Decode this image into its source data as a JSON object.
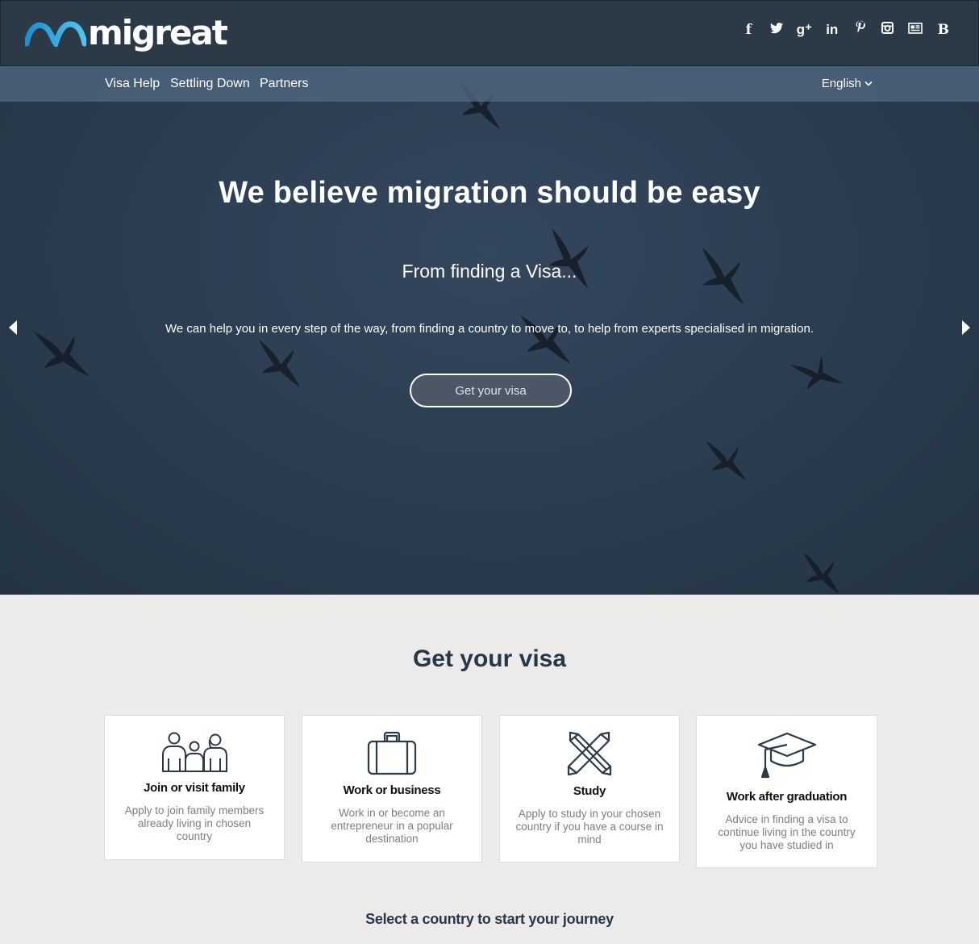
{
  "brand": {
    "name": "migreat"
  },
  "social": [
    {
      "name": "facebook-icon",
      "glyph": "f"
    },
    {
      "name": "twitter-icon",
      "glyph": "t"
    },
    {
      "name": "google-plus-icon",
      "glyph": "g⁺"
    },
    {
      "name": "linkedin-icon",
      "glyph": "in"
    },
    {
      "name": "pinterest-icon",
      "glyph": "P"
    },
    {
      "name": "instagram-icon",
      "glyph": "◙"
    },
    {
      "name": "news-icon",
      "glyph": "▤"
    },
    {
      "name": "blog-icon",
      "glyph": "B"
    }
  ],
  "nav": {
    "items": [
      "Visa Help",
      "Settling Down",
      "Partners"
    ],
    "language": "English"
  },
  "hero": {
    "title": "We believe migration should be easy",
    "subtitle": "From finding a Visa...",
    "description": "We can help you in every step of the way, from finding a country to move to, to help from experts specialised in migration.",
    "button": "Get your visa"
  },
  "visa_section": {
    "title": "Get your visa",
    "cards": [
      {
        "icon": "family-icon",
        "title": "Join or visit family",
        "desc": "Apply to join family members already living in chosen country"
      },
      {
        "icon": "briefcase-icon",
        "title": "Work or business",
        "desc": "Work in or become an entrepreneur in a popular destination"
      },
      {
        "icon": "pencils-icon",
        "title": "Study",
        "desc": "Apply to study in your chosen country if you have a course in mind"
      },
      {
        "icon": "graduation-cap-icon",
        "title": "Work after graduation",
        "desc": "Advice in finding a visa to continue living in the country you have studied in"
      }
    ]
  },
  "journey_text": "Select a country to start your journey",
  "colors": {
    "header_bg": "#2c3a47",
    "logo_accent": "#2aa8e0",
    "hero_bg": "#2e4154",
    "section_bg": "#ecebe9"
  }
}
